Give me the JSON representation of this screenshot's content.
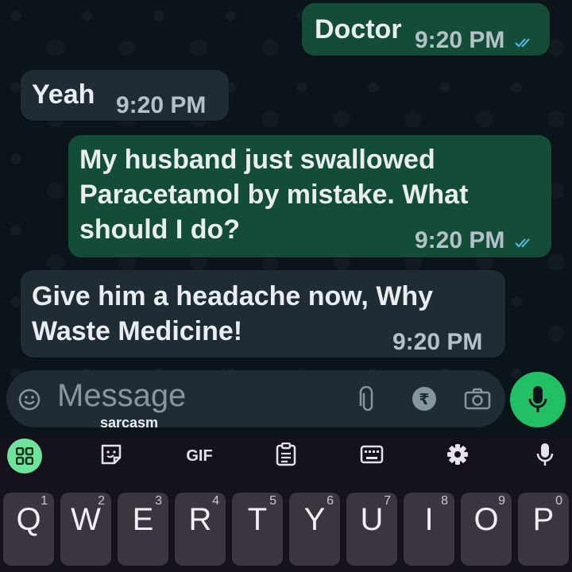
{
  "messages": [
    {
      "text": "Doctor",
      "time": "9:20 PM",
      "direction": "outgoing",
      "read": true
    },
    {
      "text": "Yeah",
      "time": "9:20 PM",
      "direction": "incoming"
    },
    {
      "lines": [
        "My husband just swallowed",
        "Paracetamol by mistake. What",
        "should I do?"
      ],
      "time": "9:20 PM",
      "direction": "outgoing",
      "read": true
    },
    {
      "lines": [
        "Give him a headache now, Why",
        "Waste Medicine!"
      ],
      "time": "9:20 PM",
      "direction": "incoming"
    }
  ],
  "composer": {
    "placeholder": "Message",
    "suggestion": "sarcasm"
  },
  "toolbar": {
    "gif_label": "GIF"
  },
  "keyboard": {
    "row1": [
      {
        "letter": "Q",
        "num": "1"
      },
      {
        "letter": "W",
        "num": "2"
      },
      {
        "letter": "E",
        "num": "3"
      },
      {
        "letter": "R",
        "num": "4"
      },
      {
        "letter": "T",
        "num": "5"
      },
      {
        "letter": "Y",
        "num": "6"
      },
      {
        "letter": "U",
        "num": "7"
      },
      {
        "letter": "I",
        "num": "8"
      },
      {
        "letter": "O",
        "num": "9"
      },
      {
        "letter": "P",
        "num": "0"
      }
    ]
  },
  "colors": {
    "chat_bg": "#0b141a",
    "outgoing_bubble": "#144d37",
    "incoming_bubble": "#1f2c34",
    "read_ticks": "#53bdeb",
    "mic_button": "#21c063",
    "keyboard_bg": "#16121b"
  },
  "icons": [
    "double-check-icon",
    "emoji-icon",
    "paperclip-icon",
    "rupee-icon",
    "camera-icon",
    "mic-icon",
    "apps-grid-icon",
    "sticker-icon",
    "clipboard-icon",
    "keyboard-icon",
    "gear-icon"
  ]
}
